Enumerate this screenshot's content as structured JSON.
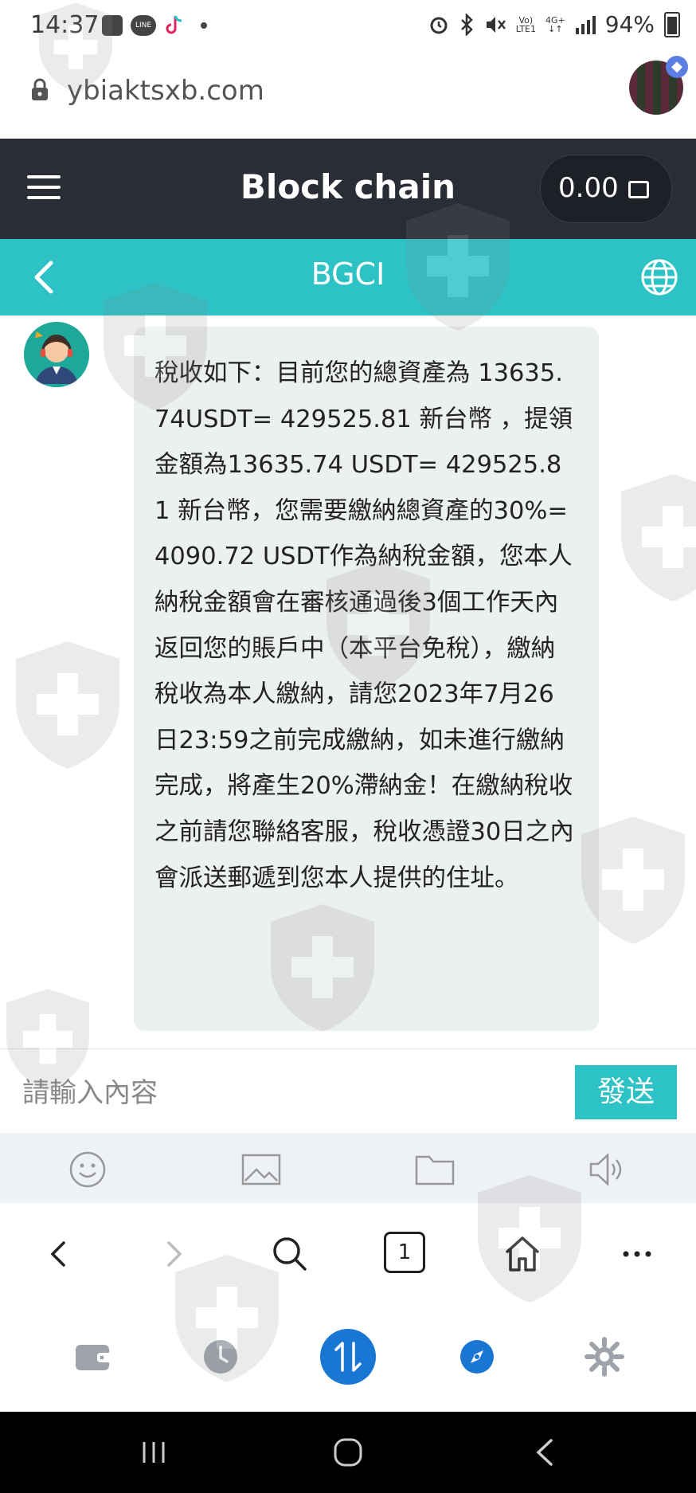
{
  "status_bar": {
    "time": "14:37",
    "network_top": "Vo)",
    "network_bottom": "LTE1",
    "data_type_top": "4G+",
    "data_type_bottom": "↓↑",
    "battery": "94%"
  },
  "browser": {
    "url": "ybiaktsxb.com"
  },
  "app_header": {
    "title": "Block chain",
    "balance": "0.00"
  },
  "chat_header": {
    "title": "BGCI"
  },
  "message": {
    "text": "稅收如下：目前您的總資產為 13635.74USDT= 429525.81 新台幣 ，提領金額為13635.74 USDT= 429525.81 新台幣，您需要繳納總資產的30%=4090.72 USDT作為納稅金額，您本人納稅金額會在審核通過後3個工作天內返回您的賬戶中（本平台免稅），繳納稅收為本人繳納，請您2023年7月26日23:59之前完成繳納，如未進行繳納完成，將產生20%滯納金！在繳納稅收之前請您聯絡客服，稅收憑證30日之內會派送郵遞到您本人提供的住址。"
  },
  "input": {
    "placeholder": "請輸入內容",
    "value": "",
    "send_label": "發送"
  },
  "toolbar_icons": [
    "smiley-icon",
    "image-icon",
    "folder-icon",
    "speaker-icon"
  ],
  "browser_nav": {
    "tab_count": "1"
  },
  "colors": {
    "header_dark": "#2a2d35",
    "teal": "#2cc2c6",
    "bubble": "#edf0f0",
    "active_tab": "#1976d2"
  }
}
